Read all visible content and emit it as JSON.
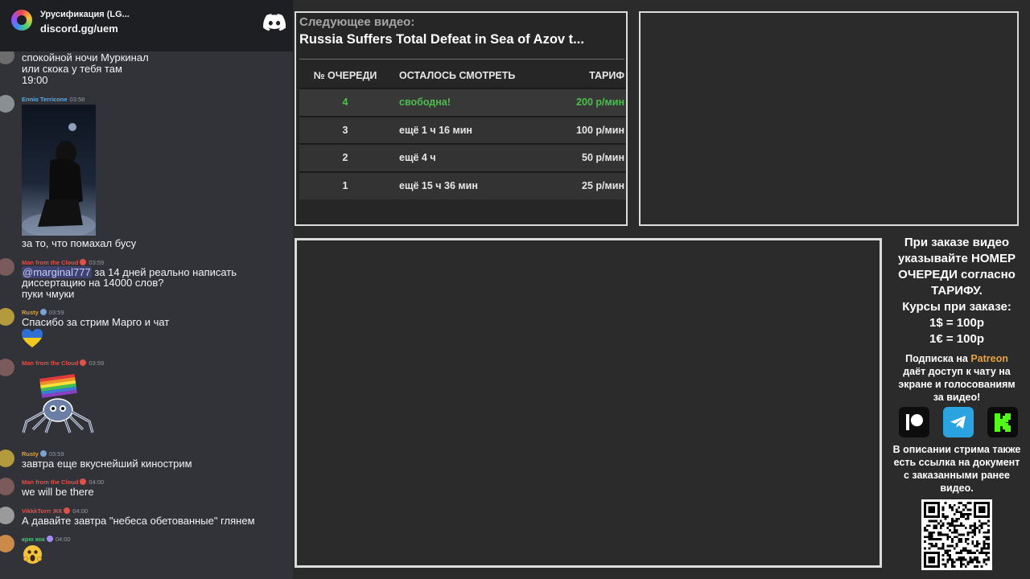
{
  "server": {
    "name": "Урусификация (LG...",
    "invite": "discord.gg/uem",
    "icon": "discord-icon"
  },
  "messages": [
    {
      "author": "",
      "time": "",
      "lines": [
        "спокойной ночи Муркинал",
        "или скока у тебя там",
        "19:00"
      ]
    },
    {
      "author": "Ennio Terricone",
      "author_color": "#5aa9e6",
      "time": "03:58",
      "attachment": "photo-person-kneeling-in-snow",
      "lines": [
        "за то, что помахал бусу"
      ]
    },
    {
      "author": "Man from the Cloud",
      "author_color": "#e0514c",
      "time": "03:59",
      "mention": "@marginal777",
      "lines": [
        "за 14 дней реально написать",
        "диссертацию на 14000 слов?",
        "пуки чмуки"
      ]
    },
    {
      "author": "Rusty",
      "author_color": "#e0a23a",
      "time": "03:59",
      "lines": [
        "Спасибо за стрим Марго и чат"
      ],
      "emoji": "heart-ukraine-emoji"
    },
    {
      "author": "Man from the Cloud",
      "author_color": "#e0514c",
      "time": "03:59",
      "lines": [],
      "emoji": "spider-rainbow-flag-sticker"
    },
    {
      "author": "Rusty",
      "author_color": "#e0a23a",
      "time": "03:59",
      "lines": [
        "завтра еще вкуснейший кинострим"
      ]
    },
    {
      "author": "Man from the Cloud",
      "author_color": "#e0514c",
      "time": "04:00",
      "lines": [
        "we will be there"
      ]
    },
    {
      "author": "VikkkTorrr ЖК",
      "author_color": "#e0514c",
      "time": "04:00",
      "lines": [
        "А давайте завтра \"небеса обетованные\" глянем"
      ]
    },
    {
      "author": "крю кок",
      "author_color": "#4fbf7a",
      "time": "04:00",
      "lines": [],
      "emoji": "shocked-face-emoji"
    }
  ],
  "queue": {
    "label": "Следующее видео:",
    "video_title": "Russia Suffers Total Defeat in Sea of Azov t...",
    "headers": [
      "№ ОЧЕРЕДИ",
      "ОСТАЛОСЬ СМОТРЕТЬ",
      "ТАРИФ"
    ],
    "rows": [
      {
        "num": "4",
        "remaining": "свободна!",
        "rate": "200 р/мин"
      },
      {
        "num": "3",
        "remaining": "ещё 1 ч 16 мин",
        "rate": "100 р/мин"
      },
      {
        "num": "2",
        "remaining": "ещё 4 ч",
        "rate": "50 р/мин"
      },
      {
        "num": "1",
        "remaining": "ещё 15 ч 36 мин",
        "rate": "25 р/мин"
      }
    ],
    "highlight_color": "#4bbf4b"
  },
  "info": {
    "order_note": [
      "При заказе видео",
      "указывайте НОМЕР",
      "ОЧЕРЕДИ согласно",
      "ТАРИФУ."
    ],
    "rates_title": "Курсы при заказе:",
    "rates": [
      "1$ = 100р",
      "1€ = 100р"
    ],
    "patreon_before": "Подписка на",
    "patreon_word": "Patreon",
    "patreon_after": [
      "даёт доступ к чату на",
      "экране и голосованиям",
      "за видео!"
    ],
    "socials": [
      "patreon-icon",
      "telegram-icon",
      "kick-icon"
    ],
    "doc_note": [
      "В описании стрима также",
      "есть ссылка на документ",
      "с заказанными ранее",
      "видео."
    ],
    "qr": "qr-code"
  }
}
